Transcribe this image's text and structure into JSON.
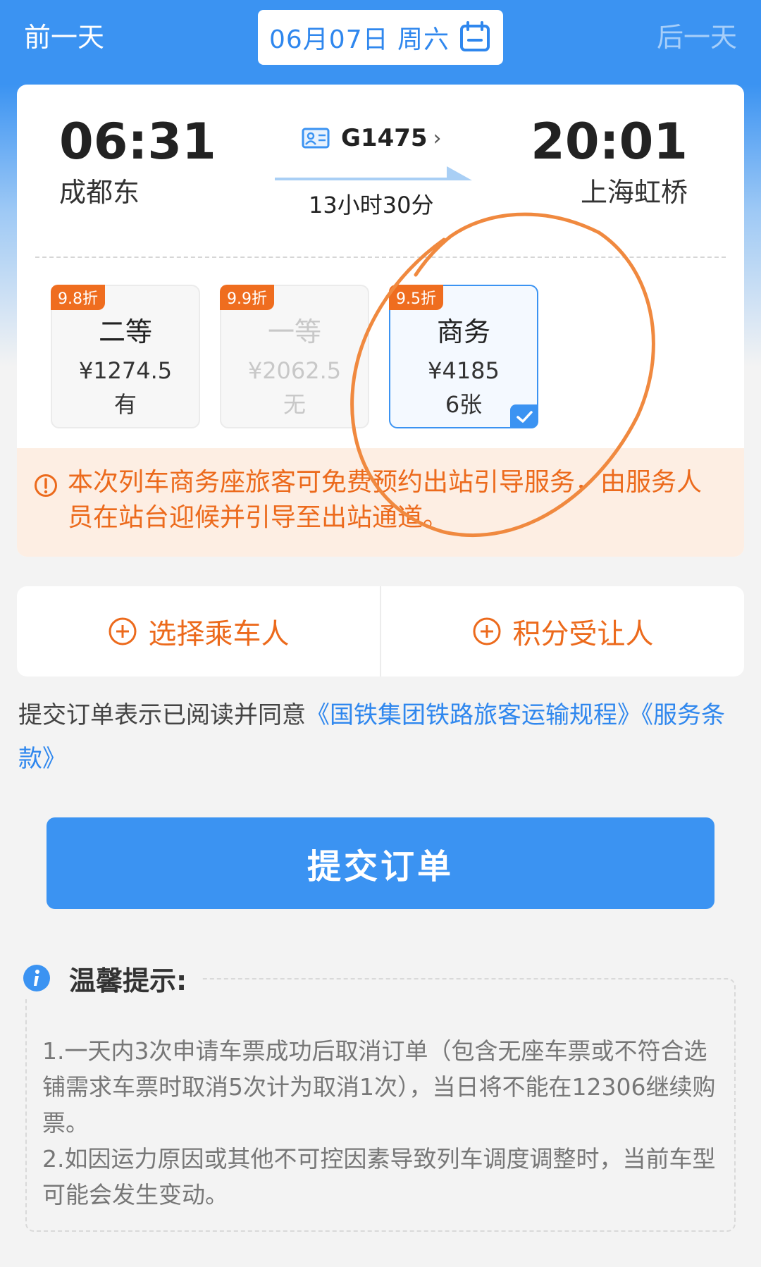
{
  "nav": {
    "prev": "前一天",
    "next": "后一天",
    "date": "06月07日 周六"
  },
  "train": {
    "dep_time": "06:31",
    "dep_station": "成都东",
    "arr_time": "20:01",
    "arr_station": "上海虹桥",
    "code": "G1475",
    "duration": "13小时30分"
  },
  "seats": [
    {
      "discount": "9.8折",
      "class": "二等",
      "price": "¥1274.5",
      "avail": "有"
    },
    {
      "discount": "9.9折",
      "class": "一等",
      "price": "¥2062.5",
      "avail": "无"
    },
    {
      "discount": "9.5折",
      "class": "商务",
      "price": "¥4185",
      "avail": "6张"
    }
  ],
  "notice": "本次列车商务座旅客可免费预约出站引导服务，由服务人员在站台迎候并引导至出站通道。",
  "passengers": {
    "choose": "选择乘车人",
    "points": "积分受让人"
  },
  "agreement": {
    "text": "提交订单表示已阅读并同意",
    "link1": "《国铁集团铁路旅客运输规程》",
    "link2": "《服务条款》"
  },
  "submit": "提交订单",
  "tips": {
    "title": "温馨提示:",
    "line1": "1.一天内3次申请车票成功后取消订单（包含无座车票或不符合选铺需求车票时取消5次计为取消1次），当日将不能在12306继续购票。",
    "line2": "2.如因运力原因或其他不可控因素导致列车调度调整时，当前车型可能会发生变动。"
  },
  "colors": {
    "primary": "#3b93f2",
    "accent": "#ec6a1c",
    "annotation": "#f0893f"
  }
}
